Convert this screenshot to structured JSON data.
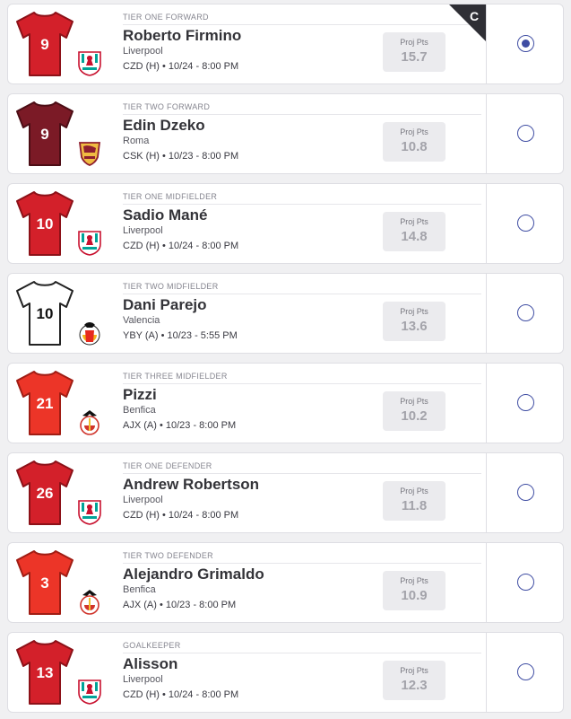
{
  "projection_label": "Proj Pts",
  "players": [
    {
      "tier": "TIER ONE FORWARD",
      "name": "Roberto Firmino",
      "team": "Liverpool",
      "match": "CZD (H) • 10/24 - 8:00 PM",
      "projected_points": "15.7",
      "jersey_number": "9",
      "jersey_style": "liverpool",
      "club_badge": "liverpool-crest-icon",
      "selected": true,
      "captain_label": "C"
    },
    {
      "tier": "TIER TWO FORWARD",
      "name": "Edin Dzeko",
      "team": "Roma",
      "match": "CSK (H) • 10/23 - 8:00 PM",
      "projected_points": "10.8",
      "jersey_number": "9",
      "jersey_style": "roma",
      "club_badge": "roma-crest-icon",
      "selected": false
    },
    {
      "tier": "TIER ONE MIDFIELDER",
      "name": "Sadio Mané",
      "team": "Liverpool",
      "match": "CZD (H) • 10/24 - 8:00 PM",
      "projected_points": "14.8",
      "jersey_number": "10",
      "jersey_style": "liverpool",
      "club_badge": "liverpool-crest-icon",
      "selected": false
    },
    {
      "tier": "TIER TWO MIDFIELDER",
      "name": "Dani Parejo",
      "team": "Valencia",
      "match": "YBY (A) • 10/23 - 5:55 PM",
      "projected_points": "13.6",
      "jersey_number": "10",
      "jersey_style": "valencia",
      "club_badge": "valencia-crest-icon",
      "selected": false
    },
    {
      "tier": "TIER THREE MIDFIELDER",
      "name": "Pizzi",
      "team": "Benfica",
      "match": "AJX (A) • 10/23 - 8:00 PM",
      "projected_points": "10.2",
      "jersey_number": "21",
      "jersey_style": "benfica",
      "club_badge": "benfica-crest-icon",
      "selected": false
    },
    {
      "tier": "TIER ONE DEFENDER",
      "name": "Andrew Robertson",
      "team": "Liverpool",
      "match": "CZD (H) • 10/24 - 8:00 PM",
      "projected_points": "11.8",
      "jersey_number": "26",
      "jersey_style": "liverpool",
      "club_badge": "liverpool-crest-icon",
      "selected": false
    },
    {
      "tier": "TIER TWO DEFENDER",
      "name": "Alejandro Grimaldo",
      "team": "Benfica",
      "match": "AJX (A) • 10/23 - 8:00 PM",
      "projected_points": "10.9",
      "jersey_number": "3",
      "jersey_style": "benfica",
      "club_badge": "benfica-crest-icon",
      "selected": false
    },
    {
      "tier": "GOALKEEPER",
      "name": "Alisson",
      "team": "Liverpool",
      "match": "CZD (H) • 10/24 - 8:00 PM",
      "projected_points": "12.3",
      "jersey_number": "13",
      "jersey_style": "liverpool",
      "club_badge": "liverpool-crest-icon",
      "selected": false
    }
  ],
  "jersey_colors": {
    "liverpool": {
      "fill": "#d3202a",
      "stroke": "#8c1118",
      "number": "#ffffff"
    },
    "roma": {
      "fill": "#7b1a26",
      "stroke": "#4c0d15",
      "number": "#ffffff"
    },
    "valencia": {
      "fill": "#ffffff",
      "stroke": "#222222",
      "number": "#111111"
    },
    "benfica": {
      "fill": "#ec3528",
      "stroke": "#a01d14",
      "number": "#ffffff"
    }
  },
  "accent_color": "#3f4da3"
}
